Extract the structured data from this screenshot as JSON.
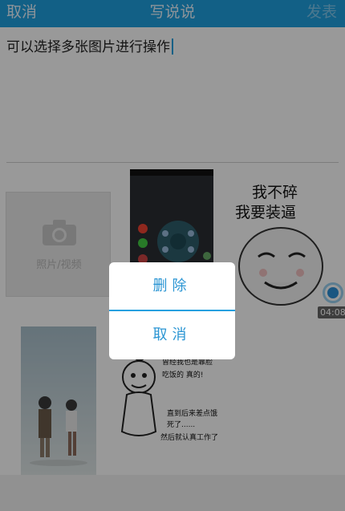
{
  "header": {
    "cancel_label": "取消",
    "title": "写说说",
    "publish_label": "发表"
  },
  "editor": {
    "text": "可以选择多张图片进行操作"
  },
  "add_tile": {
    "label": "照片/视频"
  },
  "meme1": {
    "line1": "我不碎",
    "line2": "我要装逼"
  },
  "meme2": {
    "line1": "曾经我也是靠脸",
    "line2": "吃饭的   真的!",
    "line3": "直到后来差点饿",
    "line4": "死了......",
    "line5": "然后就认真工作了"
  },
  "overlay_badge": {
    "time": "04:08"
  },
  "dialog": {
    "delete_label": "删除",
    "cancel_label": "取消"
  },
  "colors": {
    "accent": "#1fa0e0",
    "dialog_text": "#2a95d3"
  }
}
